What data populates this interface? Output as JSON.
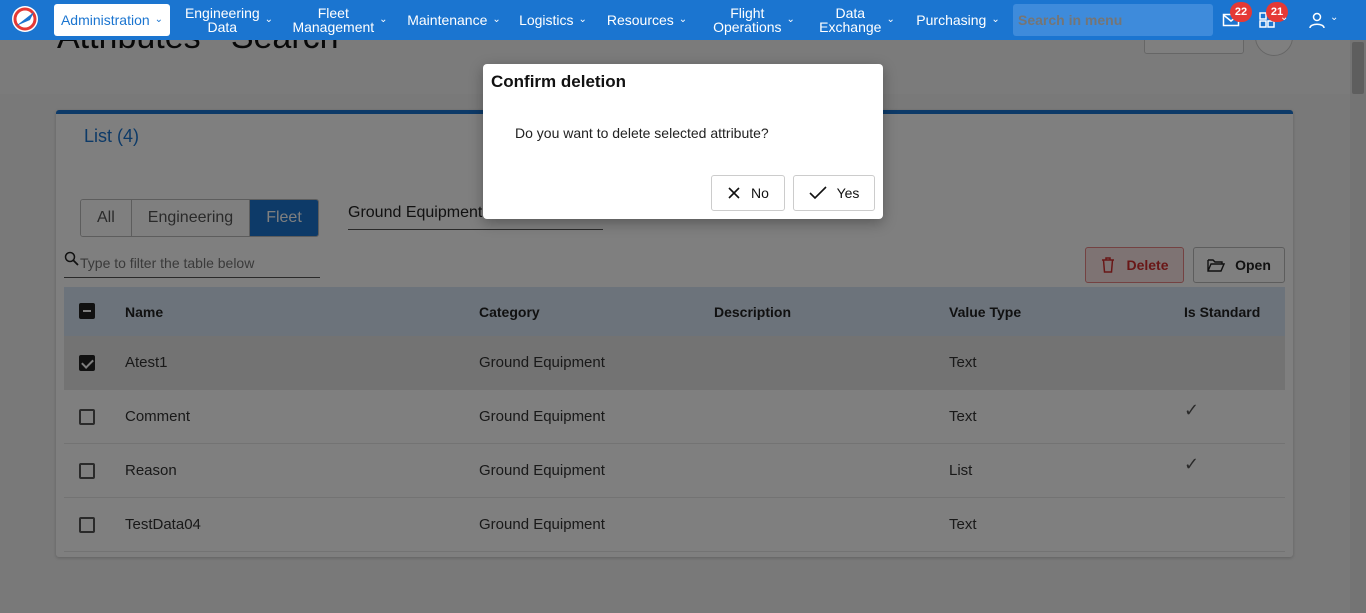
{
  "nav": {
    "items": [
      {
        "label": "Administration",
        "active": true
      },
      {
        "label": "Engineering\nData"
      },
      {
        "label": "Fleet\nManagement"
      },
      {
        "label": "Maintenance"
      },
      {
        "label": "Logistics"
      },
      {
        "label": "Resources"
      },
      {
        "label": "Flight\nOperations"
      },
      {
        "label": "Data\nExchange"
      },
      {
        "label": "Purchasing"
      }
    ],
    "search_placeholder": "Search in menu",
    "messages_badge": "22",
    "tasks_badge": "21"
  },
  "page": {
    "title": "Attributes - Search"
  },
  "list": {
    "title": "List (4)",
    "segments": [
      "All",
      "Engineering",
      "Fleet"
    ],
    "selected_segment": "Fleet",
    "category_value": "Ground Equipment",
    "filter_placeholder": "Type to filter the table below",
    "delete_label": "Delete",
    "open_label": "Open",
    "columns": [
      "Name",
      "Category",
      "Description",
      "Value Type",
      "Is Standard"
    ],
    "rows": [
      {
        "name": "Atest1",
        "category": "Ground Equipment",
        "description": "",
        "value_type": "Text",
        "is_standard": false,
        "selected": true
      },
      {
        "name": "Comment",
        "category": "Ground Equipment",
        "description": "",
        "value_type": "Text",
        "is_standard": true,
        "selected": false
      },
      {
        "name": "Reason",
        "category": "Ground Equipment",
        "description": "",
        "value_type": "List",
        "is_standard": true,
        "selected": false
      },
      {
        "name": "TestData04",
        "category": "Ground Equipment",
        "description": "",
        "value_type": "Text",
        "is_standard": false,
        "selected": false
      }
    ]
  },
  "dialog": {
    "title": "Confirm deletion",
    "message": "Do you want to delete selected attribute?",
    "no_label": "No",
    "yes_label": "Yes"
  },
  "colors": {
    "brand": "#1b75d0",
    "danger": "#d32f2f",
    "badge": "#e53935"
  }
}
